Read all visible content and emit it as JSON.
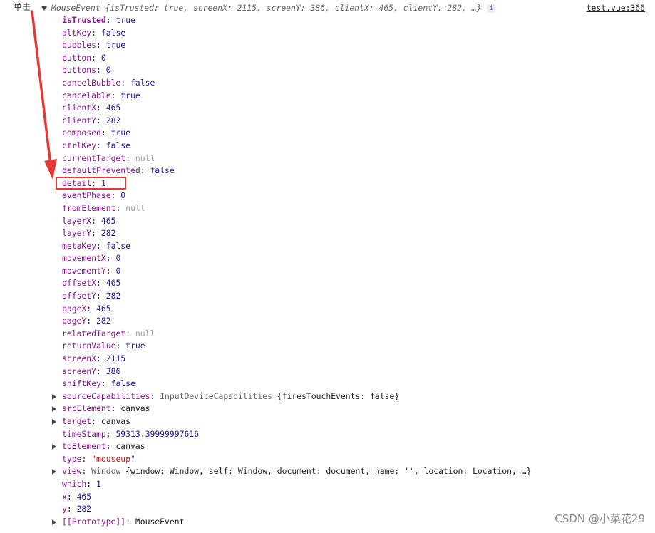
{
  "left_label": "单击",
  "header": {
    "type_name": "MouseEvent",
    "summary": "{isTrusted: true, screenX: 2115, screenY: 386, clientX: 465, clientY: 282, …}",
    "info_badge": "i",
    "source": "test.vue:366"
  },
  "properties": [
    {
      "key": "isTrusted",
      "value": "true",
      "kind": "kw",
      "bold": true
    },
    {
      "key": "altKey",
      "value": "false",
      "kind": "kw"
    },
    {
      "key": "bubbles",
      "value": "true",
      "kind": "kw"
    },
    {
      "key": "button",
      "value": "0",
      "kind": "num"
    },
    {
      "key": "buttons",
      "value": "0",
      "kind": "num"
    },
    {
      "key": "cancelBubble",
      "value": "false",
      "kind": "kw"
    },
    {
      "key": "cancelable",
      "value": "true",
      "kind": "kw"
    },
    {
      "key": "clientX",
      "value": "465",
      "kind": "num"
    },
    {
      "key": "clientY",
      "value": "282",
      "kind": "num"
    },
    {
      "key": "composed",
      "value": "true",
      "kind": "kw"
    },
    {
      "key": "ctrlKey",
      "value": "false",
      "kind": "kw"
    },
    {
      "key": "currentTarget",
      "value": "null",
      "kind": "null"
    },
    {
      "key": "defaultPrevented",
      "value": "false",
      "kind": "kw"
    },
    {
      "key": "detail",
      "value": "1",
      "kind": "num",
      "highlighted": true
    },
    {
      "key": "eventPhase",
      "value": "0",
      "kind": "num"
    },
    {
      "key": "fromElement",
      "value": "null",
      "kind": "null"
    },
    {
      "key": "layerX",
      "value": "465",
      "kind": "num"
    },
    {
      "key": "layerY",
      "value": "282",
      "kind": "num"
    },
    {
      "key": "metaKey",
      "value": "false",
      "kind": "kw"
    },
    {
      "key": "movementX",
      "value": "0",
      "kind": "num"
    },
    {
      "key": "movementY",
      "value": "0",
      "kind": "num"
    },
    {
      "key": "offsetX",
      "value": "465",
      "kind": "num"
    },
    {
      "key": "offsetY",
      "value": "282",
      "kind": "num"
    },
    {
      "key": "pageX",
      "value": "465",
      "kind": "num"
    },
    {
      "key": "pageY",
      "value": "282",
      "kind": "num"
    },
    {
      "key": "relatedTarget",
      "value": "null",
      "kind": "null"
    },
    {
      "key": "returnValue",
      "value": "true",
      "kind": "kw"
    },
    {
      "key": "screenX",
      "value": "2115",
      "kind": "num"
    },
    {
      "key": "screenY",
      "value": "386",
      "kind": "num"
    },
    {
      "key": "shiftKey",
      "value": "false",
      "kind": "kw"
    },
    {
      "key": "sourceCapabilities",
      "value_class": "InputDeviceCapabilities",
      "value": "{firesTouchEvents: false}",
      "kind": "obj",
      "expandable": true
    },
    {
      "key": "srcElement",
      "value": "canvas",
      "kind": "obj",
      "expandable": true
    },
    {
      "key": "target",
      "value": "canvas",
      "kind": "obj",
      "expandable": true
    },
    {
      "key": "timeStamp",
      "value": "59313.39999997616",
      "kind": "num"
    },
    {
      "key": "toElement",
      "value": "canvas",
      "kind": "obj",
      "expandable": true
    },
    {
      "key": "type",
      "value": "\"mouseup\"",
      "kind": "str"
    },
    {
      "key": "view",
      "value_class": "Window",
      "value": "{window: Window, self: Window, document: document, name: '', location: Location, …}",
      "kind": "obj",
      "expandable": true
    },
    {
      "key": "which",
      "value": "1",
      "kind": "num"
    },
    {
      "key": "x",
      "value": "465",
      "kind": "num"
    },
    {
      "key": "y",
      "value": "282",
      "kind": "num"
    },
    {
      "key": "[[Prototype]]",
      "value": "MouseEvent",
      "kind": "obj",
      "expandable": true
    }
  ],
  "watermark": "CSDN @小菜花29",
  "colors": {
    "key": "#881391",
    "keyword": "#1a1aa6",
    "null": "#9aa0a6",
    "string": "#c41a16",
    "annotation": "#e53935"
  },
  "icons": [
    "expand-triangle-icon",
    "collapse-triangle-icon",
    "info-icon",
    "red-arrow-annotation"
  ]
}
